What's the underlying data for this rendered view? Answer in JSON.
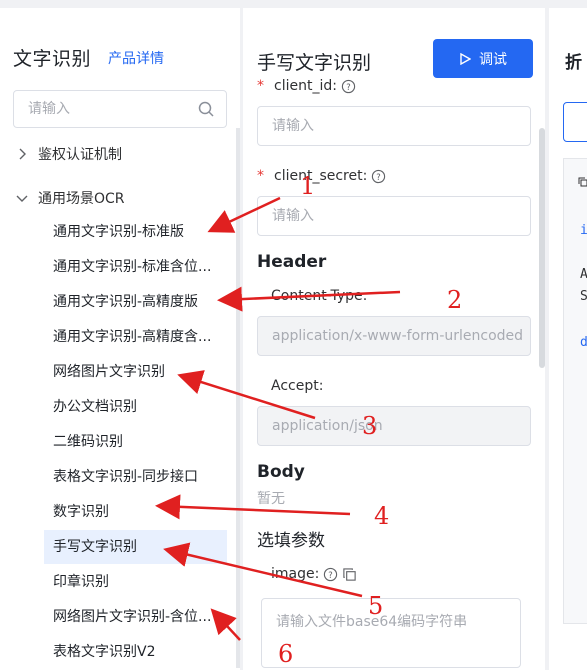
{
  "sidebar": {
    "title": "文字识别",
    "product_link": "产品详情",
    "search_placeholder": "请输入",
    "groups": [
      {
        "label": "鉴权认证机制",
        "expanded": false
      },
      {
        "label": "通用场景OCR",
        "expanded": true
      }
    ],
    "items": [
      {
        "label": "通用文字识别-标准版",
        "active": false
      },
      {
        "label": "通用文字识别-标准含位...",
        "active": false
      },
      {
        "label": "通用文字识别-高精度版",
        "active": false
      },
      {
        "label": "通用文字识别-高精度含...",
        "active": false
      },
      {
        "label": "网络图片文字识别",
        "active": false
      },
      {
        "label": "办公文档识别",
        "active": false
      },
      {
        "label": "二维码识别",
        "active": false
      },
      {
        "label": "表格文字识别-同步接口",
        "active": false
      },
      {
        "label": "数字识别",
        "active": false
      },
      {
        "label": "手写文字识别",
        "active": true
      },
      {
        "label": "印章识别",
        "active": false
      },
      {
        "label": "网络图片文字识别-含位...",
        "active": false
      },
      {
        "label": "表格文字识别V2",
        "active": false
      }
    ]
  },
  "main": {
    "title": "手写文字识别",
    "debug_button": "调试",
    "client_id_label": "client_id:",
    "client_id_placeholder": "请输入",
    "client_secret_label": "client_secret:",
    "client_secret_placeholder": "请输入",
    "header_section": "Header",
    "content_type_label": "Content-Type:",
    "content_type_value": "application/x-www-form-urlencoded",
    "accept_label": "Accept:",
    "accept_value": "application/json",
    "body_section": "Body",
    "body_empty": "暂无",
    "optional_section": "选填参数",
    "image_label": "image:",
    "image_placeholder": "请输入文件base64编码字符串"
  },
  "right_panel": {
    "tab_char": "折",
    "code_lines": [
      "i",
      "A",
      "S",
      "d"
    ]
  },
  "annotations": {
    "numbers": [
      "1",
      "2",
      "3",
      "4",
      "5",
      "6"
    ],
    "color": "#e02020"
  },
  "colors": {
    "accent": "#2468f2",
    "active_bg": "#e8f0fe",
    "required": "#e53935"
  }
}
